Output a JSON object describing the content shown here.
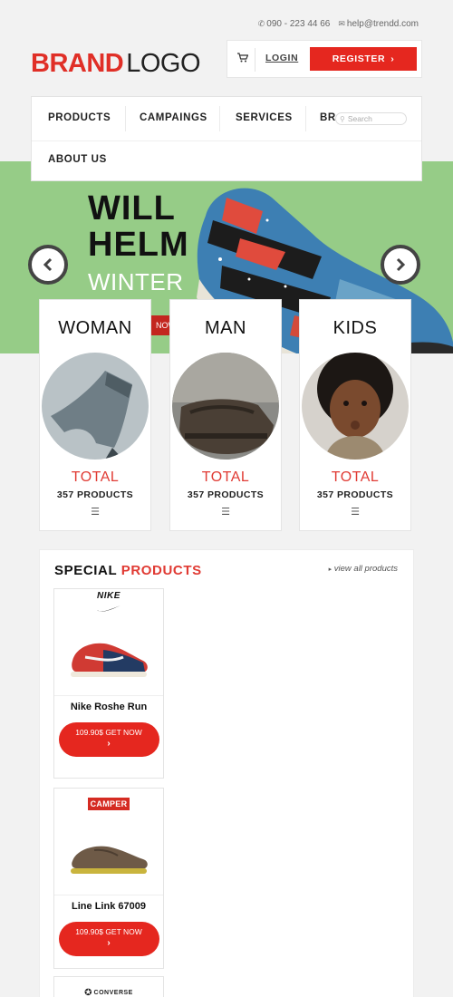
{
  "contact": {
    "phone": "090 - 223 44 66",
    "email": "help@trendd.com"
  },
  "brand": {
    "bold": "BRAND",
    "light": "LOGO"
  },
  "account": {
    "login": "LOGIN",
    "register": "REGISTER",
    "register_arrow": "›"
  },
  "nav": {
    "items": [
      "PRODUCTS",
      "CAMPAINGS",
      "SERVICES",
      "BR",
      "ABOUT US"
    ],
    "search_placeholder": "Search"
  },
  "hero": {
    "title_line1": "WILL",
    "title_line2": "HELM",
    "subtitle": "WINTER",
    "cta": "NOW"
  },
  "categories": [
    {
      "name": "WOMAN",
      "total": "TOTAL",
      "count": "357 PRODUCTS"
    },
    {
      "name": "MAN",
      "total": "TOTAL",
      "count": "357 PRODUCTS"
    },
    {
      "name": "KIDS",
      "total": "TOTAL",
      "count": "357 PRODUCTS"
    }
  ],
  "special": {
    "title_black": "SPECIAL",
    "title_red": "PRODUCTS",
    "view_all": "view all products",
    "products": [
      {
        "brand": "NIKE",
        "name": "Nike Roshe Run",
        "price": "109.90$",
        "action": "GET NOW"
      },
      {
        "brand": "CAMPER",
        "name": "Line Link 67009",
        "price": "109.90$",
        "action": "GET NOW"
      },
      {
        "brand": "CONVERSE"
      }
    ]
  },
  "colors": {
    "accent": "#e5271f",
    "hero_bg": "#96cc87",
    "page_bg": "#f2f2f2"
  },
  "icons": {
    "phone": "phone-icon",
    "mail": "mail-icon",
    "cart": "cart-icon",
    "search": "search-icon",
    "prev": "chevron-left-icon",
    "next": "chevron-right-icon",
    "menu": "menu-icon"
  }
}
